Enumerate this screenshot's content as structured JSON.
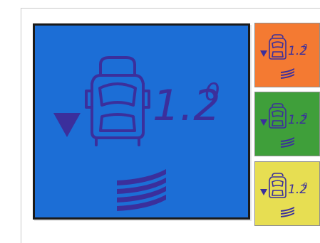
{
  "main_display": {
    "value": "1.2",
    "unit": "0",
    "background_color": "#1c6ed6",
    "indicator_icon": "arrow-down-icon",
    "vehicle_icon": "car-top-view-icon",
    "levels_icon": "level-bars-icon"
  },
  "tiles": [
    {
      "value": "1.2",
      "unit": "0",
      "color": "#f47a32"
    },
    {
      "value": "1.2",
      "unit": "0",
      "color": "#3f9f3a"
    },
    {
      "value": "1.2",
      "unit": "0",
      "color": "#e7de52"
    }
  ],
  "lcd_foreground_color": "#3b2f9c"
}
